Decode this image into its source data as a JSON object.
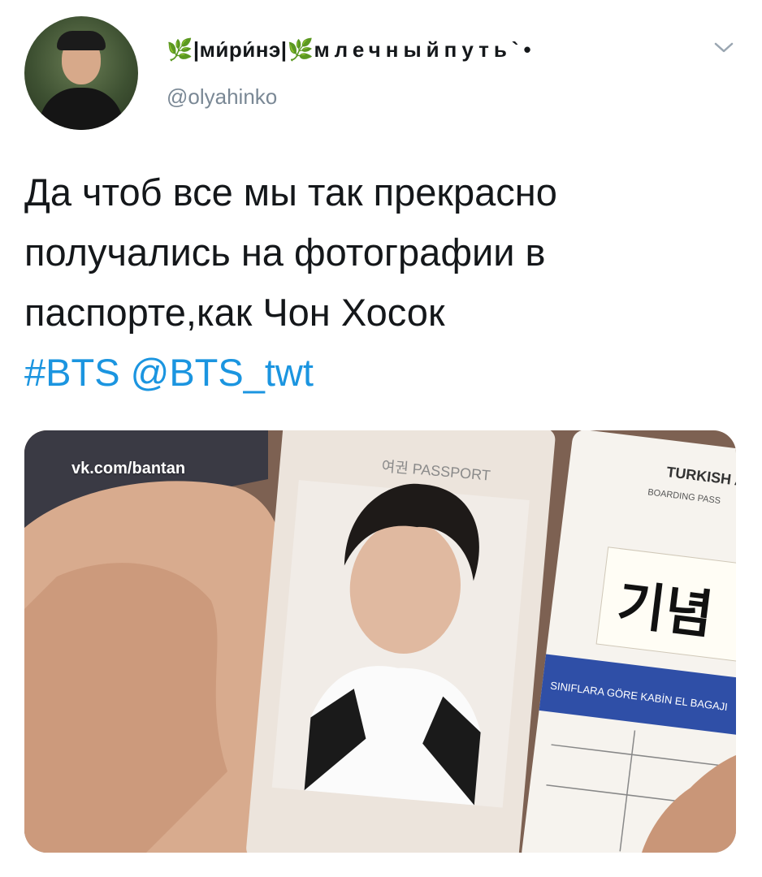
{
  "tweet": {
    "author": {
      "display_name_part1": "|ми́ри́нэ|",
      "display_name_part2": "млечныйпуть`•",
      "handle": "@olyahinko"
    },
    "text_lines": [
      "Да чтоб все мы так прекрасно",
      "получались на фотографии в",
      "паспорте,как Чон Хосок"
    ],
    "hashtag": "#BTS",
    "mention": "@BTS_twt",
    "media": {
      "watermark": "vk.com/bantan",
      "passport_label": "여권 PASSPORT",
      "airline": "TURKISH AIRLINES",
      "boarding_pass": "BOARDING PASS",
      "korean_sign": "기념",
      "baggage_text": "SINIFLARA GÖRE KABİN EL BAGAJI"
    }
  },
  "colors": {
    "link": "#1b95e0",
    "text": "#14171a",
    "muted": "#7a8895"
  },
  "icons": {
    "name_decoration": "leaf-emoji-icon",
    "menu": "chevron-down-icon"
  }
}
